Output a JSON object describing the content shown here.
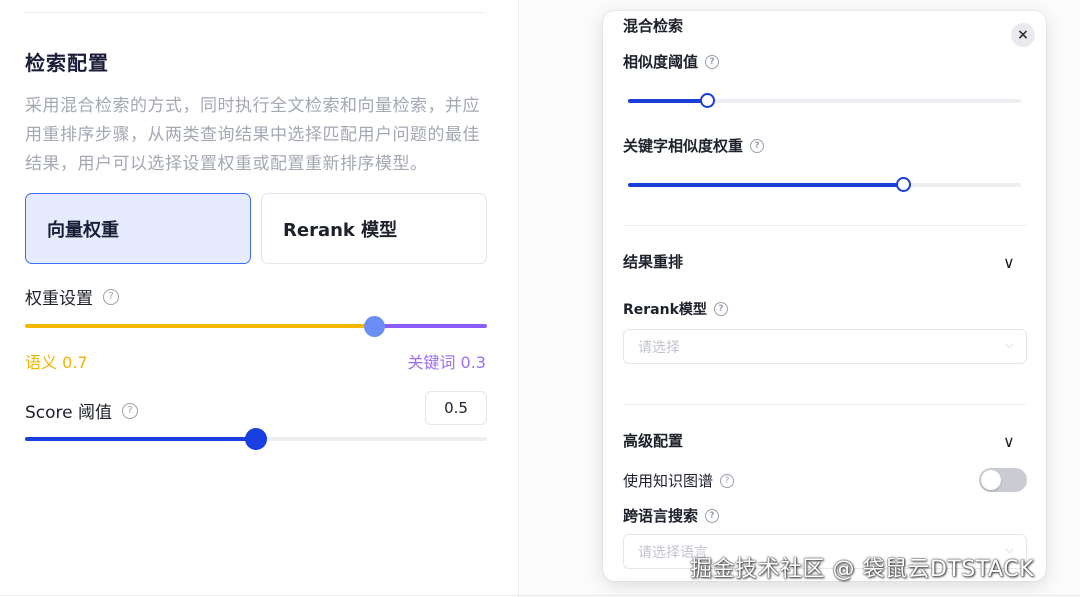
{
  "left": {
    "section_title": "检索配置",
    "description": "采用混合检索的方式，同时执行全文检索和向量检索，并应用重排序步骤，从两类查询结果中选择匹配用户问题的最佳结果，用户可以选择设置权重或配置重新排序模型。",
    "options": [
      {
        "label": "向量权重",
        "selected": true
      },
      {
        "label": "Rerank 模型",
        "selected": false
      }
    ],
    "weight": {
      "label": "权重设置",
      "semantic_label": "语义 0.7",
      "keyword_label": "关键词 0.3",
      "semantic_value": 0.7,
      "semantic_color": "#f5b800",
      "keyword_color": "#8b5cf6",
      "thumb_color": "#6b8ef5"
    },
    "score": {
      "label": "Score 阈值",
      "value": "0.5",
      "fraction": 0.5,
      "color": "#1a3fe0"
    }
  },
  "dialog": {
    "title": "混合检索",
    "close_icon": "×",
    "similarity_threshold": {
      "label": "相似度阈值",
      "fraction": 0.2
    },
    "keyword_similarity_weight": {
      "label": "关键字相似度权重",
      "fraction": 0.7
    },
    "rerank_section": {
      "title": "结果重排",
      "chevron": "∨"
    },
    "rerank_model": {
      "label": "Rerank模型",
      "placeholder": "请选择"
    },
    "advanced_section": {
      "title": "高级配置",
      "chevron": "∨"
    },
    "use_knowledge_graph": {
      "label": "使用知识图谱",
      "enabled": false
    },
    "cross_language": {
      "label": "跨语言搜索",
      "placeholder": "请选择语言"
    }
  },
  "icons": {
    "help": "?",
    "select_arrow": "⌵"
  },
  "watermark": "掘金技术社区 @ 袋鼠云DTSTACK"
}
